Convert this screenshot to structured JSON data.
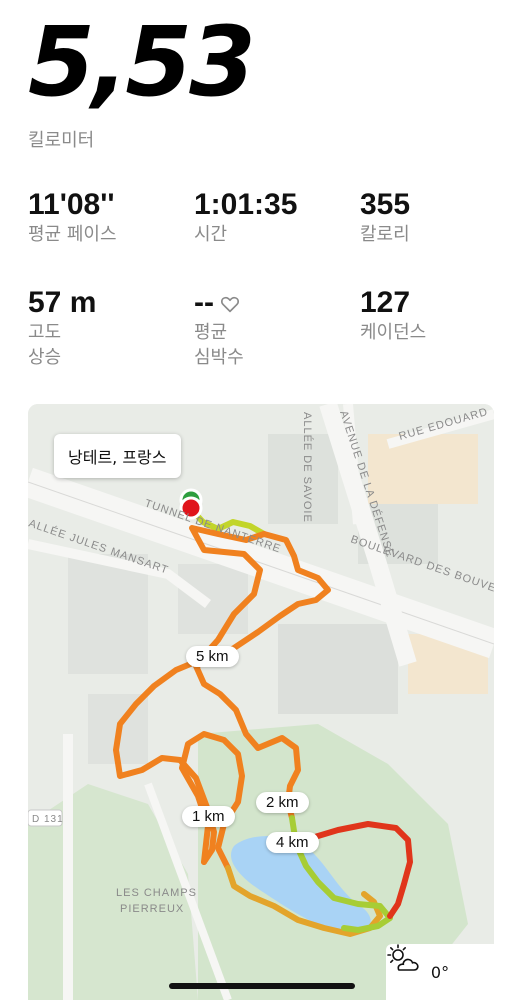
{
  "summary": {
    "distance": "5,53",
    "distance_unit": "킬로미터"
  },
  "stats": {
    "pace": {
      "value": "11'08''",
      "label": "평균 페이스"
    },
    "time": {
      "value": "1:01:35",
      "label": "시간"
    },
    "calories": {
      "value": "355",
      "label": "칼로리"
    },
    "elevation": {
      "value": "57 m",
      "label": "고도\n상승"
    },
    "heart_rate": {
      "value": "--",
      "label": "평균\n심박수",
      "icon": "heart-outline-icon"
    },
    "cadence": {
      "value": "127",
      "label": "케이던스"
    }
  },
  "map": {
    "location": "낭테르, 프랑스",
    "streets": [
      "TUNNEL DE NANTERRE",
      "BOULEVARD DES BOUVETS",
      "AVENUE DE LA DÉFENSE",
      "RUE EDOUARD",
      "ALLÉE DE SAVOIE",
      "ALLÉE JULES MANSART",
      "LES CHAMPS",
      "PIERREUX",
      "D 131"
    ],
    "km_markers": [
      "1 km",
      "2 km",
      "4 km",
      "5 km"
    ],
    "start_color": "#2e9e3e",
    "end_color": "#e0141b",
    "route_colors": [
      "#f0811f",
      "#c2d52a",
      "#e0351b"
    ]
  },
  "weather": {
    "temperature": "0°",
    "icon": "partly-cloudy-sun-icon"
  }
}
